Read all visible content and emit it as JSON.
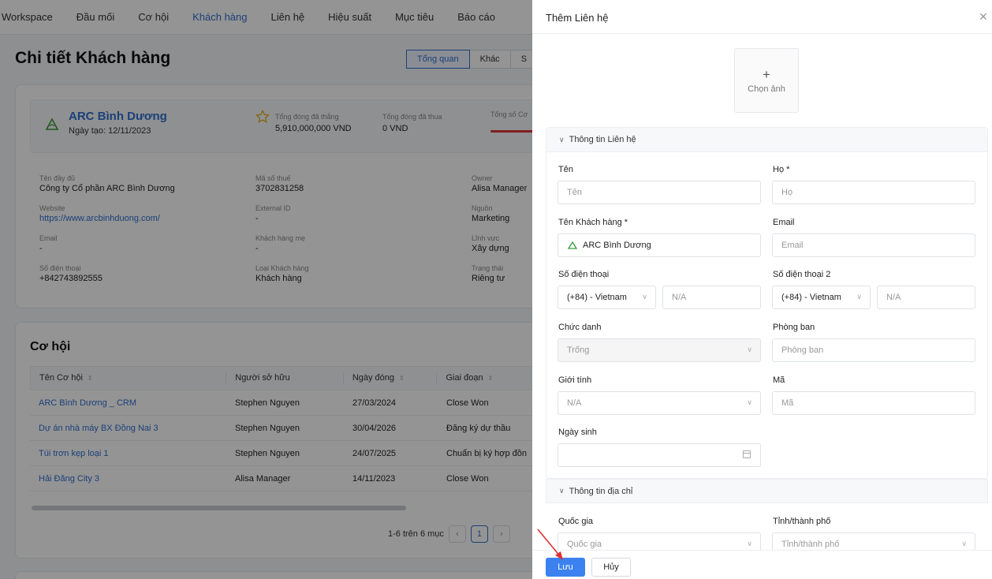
{
  "nav": {
    "items": [
      "Workspace",
      "Đầu mối",
      "Cơ hội",
      "Khách hàng",
      "Liên hệ",
      "Hiệu suất",
      "Mục tiêu",
      "Báo cáo"
    ],
    "active_index": 3
  },
  "page": {
    "title": "Chi tiết Khách hàng",
    "tabs": [
      "Tổng quan",
      "Khác",
      "S"
    ]
  },
  "account": {
    "name": "ARC Bình Dương",
    "created": "Ngày tạo: 12/11/2023",
    "won_label": "Tổng đóng đã thắng",
    "won_value": "5,910,000,000 VND",
    "lost_label": "Tổng đóng đã thua",
    "lost_value": "0 VND",
    "total_label": "Tổng số Cơ"
  },
  "details": {
    "full_name_label": "Tên đầy đủ",
    "full_name": "Công ty Cổ phần ARC Bình Dương",
    "tax_label": "Mã số thuế",
    "tax": "3702831258",
    "owner_label": "Owner",
    "owner": "Alisa Manager",
    "website_label": "Website",
    "website": "https://www.arcbinhduong.com/",
    "ext_label": "External ID",
    "ext": "-",
    "source_label": "Nguồn",
    "source": "Marketing",
    "email_label": "Email",
    "email": "-",
    "parent_label": "Khách hàng mẹ",
    "parent": "-",
    "field_label": "Lĩnh vực",
    "field": "Xây dựng",
    "phone_label": "Số điện thoại",
    "phone": "+842743892555",
    "type_label": "Loại Khách hàng",
    "type": "Khách hàng",
    "status_label": "Trạng thái",
    "status": "Riêng tư"
  },
  "opps": {
    "title": "Cơ hội",
    "headers": [
      "Tên Cơ hội",
      "Người sở hữu",
      "Ngày đóng",
      "Giai đoạn"
    ],
    "rows": [
      [
        "ARC Bình Dương _ CRM",
        "Stephen Nguyen",
        "27/03/2024",
        "Close Won"
      ],
      [
        "Dự án nhà máy BX Đồng Nai 3",
        "Stephen Nguyen",
        "30/04/2026",
        "Đăng ký dự thầu"
      ],
      [
        "Túi trơn kẹp loại 1",
        "Stephen Nguyen",
        "24/07/2025",
        "Chuẩn bị ký hợp đồn"
      ],
      [
        "Hải Đăng City 3",
        "Alisa Manager",
        "14/11/2023",
        "Close Won"
      ]
    ],
    "pager_text": "1-6 trên 6 mục",
    "page": "1"
  },
  "drawer": {
    "title": "Thêm Liên hệ",
    "avatar_plus": "+",
    "avatar_text": "Chọn ảnh",
    "section1": "Thông tin Liên hệ",
    "section2": "Thông tin địa chỉ",
    "first_name_label": "Tên",
    "first_name_ph": "Tên",
    "last_name_label": "Họ *",
    "last_name_ph": "Họ",
    "account_label": "Tên Khách hàng *",
    "account_value": "ARC Bình Dương",
    "email_label": "Email",
    "email_ph": "Email",
    "phone_label": "Số điện thoại",
    "phone_code": "(+84) - Vietnam",
    "phone_ph": "N/A",
    "phone2_label": "Số điện thoại 2",
    "phone2_code": "(+84) - Vietnam",
    "phone2_ph": "N/A",
    "title_label": "Chức danh",
    "title_value": "Trống",
    "dept_label": "Phòng ban",
    "dept_ph": "Phòng ban",
    "gender_label": "Giới tính",
    "gender_value": "N/A",
    "code_label": "Mã",
    "code_ph": "Mã",
    "dob_label": "Ngày sinh",
    "country_label": "Quốc gia",
    "country_ph": "Quốc gia",
    "city_label": "Tỉnh/thành phố",
    "city_ph": "Tỉnh/thành phố",
    "save": "Lưu",
    "cancel": "Hủy"
  },
  "colors": {
    "accent": "#3b82f0",
    "link": "#2f6fd1",
    "annotation": "#e03030"
  }
}
